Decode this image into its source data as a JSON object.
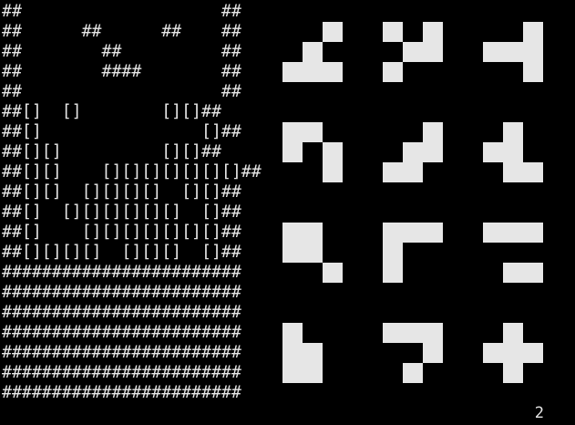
{
  "colors": {
    "background": "#000000",
    "foreground": "#e6e6e6"
  },
  "board": {
    "rows": [
      "##                    ##",
      "##      ##      ##    ##",
      "##        ##          ##",
      "##        ####        ##",
      "##                    ##",
      "##[]  []        [][]##",
      "##[]                []##",
      "##[][]          [][]##",
      "##[][]    [][][][][][][]##",
      "##[][]  [][][][]  [][]##",
      "##[]  [][][][][][]  []##",
      "##[]    [][][][][][][]##",
      "##[][][][]  [][][]  []##",
      "########################",
      "########################",
      "########################",
      "########################",
      "########################",
      "########################",
      "########################"
    ]
  },
  "pieces": [
    {
      "name": "piece-1",
      "cells": [
        [
          2,
          0
        ],
        [
          1,
          1
        ],
        [
          0,
          2
        ],
        [
          1,
          2
        ],
        [
          2,
          2
        ]
      ]
    },
    {
      "name": "piece-2",
      "cells": [
        [
          0,
          0
        ],
        [
          2,
          0
        ],
        [
          1,
          1
        ],
        [
          2,
          1
        ],
        [
          0,
          2
        ]
      ]
    },
    {
      "name": "piece-3",
      "cells": [
        [
          2,
          0
        ],
        [
          0,
          1
        ],
        [
          1,
          1
        ],
        [
          2,
          1
        ],
        [
          2,
          2
        ]
      ]
    },
    {
      "name": "piece-4",
      "cells": [
        [
          0,
          0
        ],
        [
          1,
          0
        ],
        [
          0,
          1
        ],
        [
          2,
          1
        ],
        [
          2,
          2
        ]
      ]
    },
    {
      "name": "piece-5",
      "cells": [
        [
          2,
          0
        ],
        [
          1,
          1
        ],
        [
          2,
          1
        ],
        [
          0,
          2
        ],
        [
          1,
          2
        ]
      ]
    },
    {
      "name": "piece-6",
      "cells": [
        [
          1,
          0
        ],
        [
          0,
          1
        ],
        [
          1,
          1
        ],
        [
          1,
          2
        ],
        [
          2,
          2
        ]
      ]
    },
    {
      "name": "piece-7",
      "cells": [
        [
          0,
          0
        ],
        [
          1,
          0
        ],
        [
          0,
          1
        ],
        [
          1,
          1
        ],
        [
          2,
          2
        ]
      ]
    },
    {
      "name": "piece-8",
      "cells": [
        [
          0,
          0
        ],
        [
          1,
          0
        ],
        [
          2,
          0
        ],
        [
          0,
          1
        ],
        [
          0,
          2
        ]
      ]
    },
    {
      "name": "piece-9",
      "cells": [
        [
          0,
          0
        ],
        [
          1,
          0
        ],
        [
          2,
          0
        ],
        [
          1,
          2
        ],
        [
          2,
          2
        ]
      ]
    },
    {
      "name": "piece-10",
      "cells": [
        [
          0,
          0
        ],
        [
          0,
          1
        ],
        [
          1,
          1
        ],
        [
          0,
          2
        ],
        [
          1,
          2
        ]
      ]
    },
    {
      "name": "piece-11",
      "cells": [
        [
          0,
          0
        ],
        [
          1,
          0
        ],
        [
          2,
          0
        ],
        [
          2,
          1
        ],
        [
          1,
          2
        ]
      ]
    },
    {
      "name": "piece-12",
      "cells": [
        [
          1,
          0
        ],
        [
          0,
          1
        ],
        [
          1,
          1
        ],
        [
          2,
          1
        ],
        [
          1,
          2
        ]
      ]
    }
  ],
  "score": "2"
}
